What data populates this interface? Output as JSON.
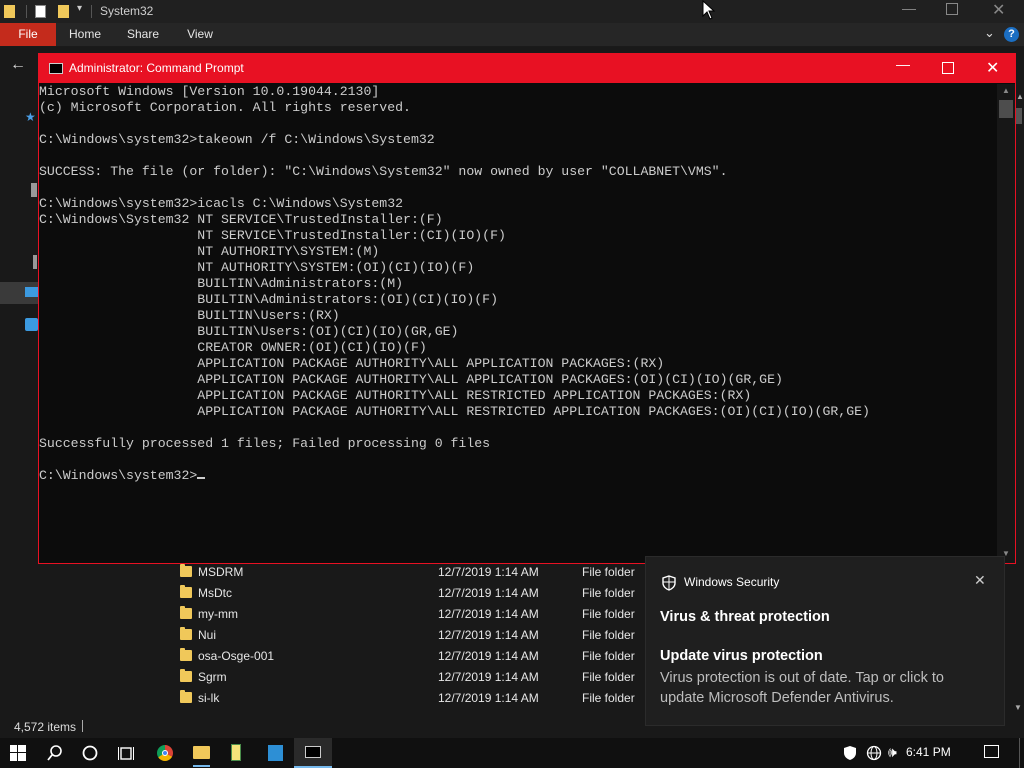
{
  "explorer": {
    "title": "System32",
    "ribbon": {
      "file": "File",
      "home": "Home",
      "share": "Share",
      "view": "View"
    },
    "help_icon": "?",
    "files": [
      {
        "name": "MSDRM",
        "date": "12/7/2019 1:14 AM",
        "type": "File folder"
      },
      {
        "name": "MsDtc",
        "date": "12/7/2019 1:14 AM",
        "type": "File folder"
      },
      {
        "name": "my-mm",
        "date": "12/7/2019 1:14 AM",
        "type": "File folder"
      },
      {
        "name": "Nui",
        "date": "12/7/2019 1:14 AM",
        "type": "File folder"
      },
      {
        "name": "osa-Osge-001",
        "date": "12/7/2019 1:14 AM",
        "type": "File folder"
      },
      {
        "name": "Sgrm",
        "date": "12/7/2019 1:14 AM",
        "type": "File folder"
      },
      {
        "name": "si-lk",
        "date": "12/7/2019 1:14 AM",
        "type": "File folder"
      }
    ],
    "status": {
      "items": "4,572 items"
    }
  },
  "cmd": {
    "title": "Administrator: Command Prompt",
    "lines": [
      "Microsoft Windows [Version 10.0.19044.2130]",
      "(c) Microsoft Corporation. All rights reserved.",
      "",
      "C:\\Windows\\system32>takeown /f C:\\Windows\\System32",
      "",
      "SUCCESS: The file (or folder): \"C:\\Windows\\System32\" now owned by user \"COLLABNET\\VMS\".",
      "",
      "C:\\Windows\\system32>icacls C:\\Windows\\System32",
      "C:\\Windows\\System32 NT SERVICE\\TrustedInstaller:(F)",
      "                    NT SERVICE\\TrustedInstaller:(CI)(IO)(F)",
      "                    NT AUTHORITY\\SYSTEM:(M)",
      "                    NT AUTHORITY\\SYSTEM:(OI)(CI)(IO)(F)",
      "                    BUILTIN\\Administrators:(M)",
      "                    BUILTIN\\Administrators:(OI)(CI)(IO)(F)",
      "                    BUILTIN\\Users:(RX)",
      "                    BUILTIN\\Users:(OI)(CI)(IO)(GR,GE)",
      "                    CREATOR OWNER:(OI)(CI)(IO)(F)",
      "                    APPLICATION PACKAGE AUTHORITY\\ALL APPLICATION PACKAGES:(RX)",
      "                    APPLICATION PACKAGE AUTHORITY\\ALL APPLICATION PACKAGES:(OI)(CI)(IO)(GR,GE)",
      "                    APPLICATION PACKAGE AUTHORITY\\ALL RESTRICTED APPLICATION PACKAGES:(RX)",
      "                    APPLICATION PACKAGE AUTHORITY\\ALL RESTRICTED APPLICATION PACKAGES:(OI)(CI)(IO)(GR,GE)",
      "",
      "Successfully processed 1 files; Failed processing 0 files",
      ""
    ],
    "prompt": "C:\\Windows\\system32>"
  },
  "toast": {
    "app": "Windows Security",
    "heading": "Virus & threat protection",
    "subheading": "Update virus protection",
    "body": "Virus protection is out of date. Tap or click to update Microsoft Defender Antivirus."
  },
  "taskbar": {
    "clock": "6:41 PM",
    "apps": [
      "start-icon",
      "search-icon",
      "cortana-icon",
      "task-view-icon",
      "chrome-icon",
      "file-explorer-icon",
      "notepad-icon",
      "calculator-icon",
      "command-prompt-icon"
    ]
  },
  "colors": {
    "accent_red": "#e81123",
    "file_tab": "#c42b1c",
    "taskbar_active": "#76b9ed"
  }
}
